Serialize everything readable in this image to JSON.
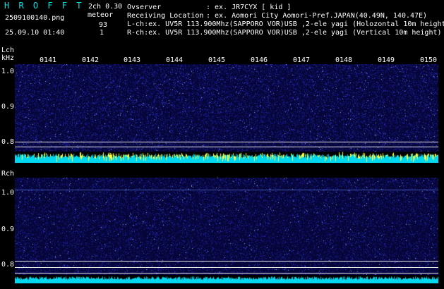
{
  "header": {
    "title": "H R O F F T",
    "version": "2ch 0.30",
    "filename": "2509100140.png",
    "datetime": "25.09.10 01:40",
    "meteor_label": "meteor",
    "meteor_lch": "93",
    "meteor_rch": "1",
    "observer_label": "Ovserver",
    "observer_value": ": ex. JR7CYX [ kid ]",
    "location_label": "Receiving Location",
    "location_value": ": ex. Aomori City Aomori-Pref.JAPAN(40.49N, 140.47E)",
    "lch_info": "L-ch:ex. UV5R 113.900Mhz(SAPPORO VOR)USB ,2-ele yagi (Holozontal 10m height",
    "rch_info": "R-ch:ex. UV5R 113.900Mhz(SAPPORO VOR)USB ,2-ele yagi (Vertical 10m height)"
  },
  "time_labels": [
    "0141",
    "0142",
    "0143",
    "0144",
    "0145",
    "0146",
    "0147",
    "0148",
    "0149",
    "0150"
  ],
  "lch": {
    "label": "Lch",
    "unit": "kHz",
    "freq_labels": [
      "1.0",
      "0.9",
      "0.8"
    ]
  },
  "rch": {
    "label": "Rch",
    "freq_labels": [
      "1.0",
      "0.9",
      "0.8"
    ]
  },
  "colors": {
    "title": "#00e0e0",
    "background": "#000000",
    "spectrogram": "#0a0a78",
    "level_cyan": "#00e5ff",
    "level_yellow": "#ffff40"
  }
}
